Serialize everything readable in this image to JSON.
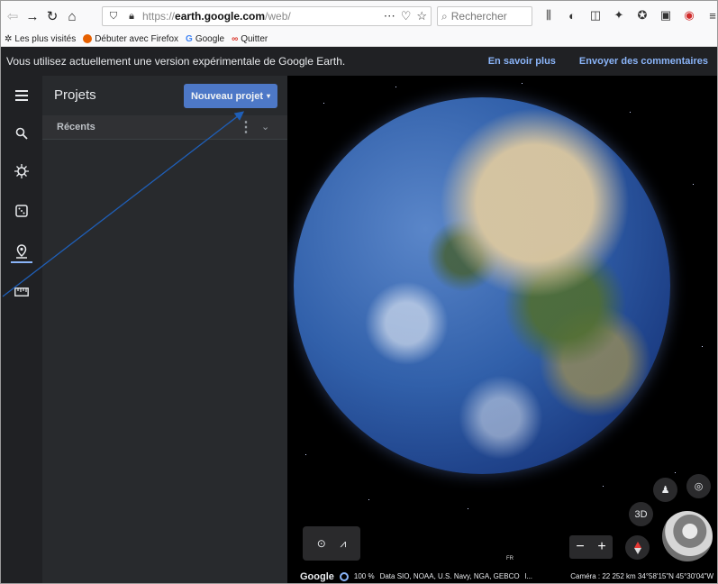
{
  "browser": {
    "url": {
      "prefix": "https://",
      "host": "earth.google.com",
      "path": "/web/"
    },
    "search_placeholder": "Rechercher",
    "bookmarks": [
      "Les plus visités",
      "Débuter avec Firefox",
      "Google",
      "Quitter"
    ]
  },
  "banner": {
    "message": "Vous utilisez actuellement une version expérimentale de Google Earth.",
    "learn_more": "En savoir plus",
    "feedback": "Envoyer des commentaires"
  },
  "panel": {
    "title": "Projets",
    "new_project": "Nouveau projet",
    "recent": "Récents"
  },
  "map": {
    "mode_3d": "3D",
    "zoom_out": "−",
    "zoom_in": "+",
    "country_label": "FR",
    "footer": {
      "brand": "Google",
      "percent": "100 %",
      "data": "Data SIO, NOAA, U.S. Navy, NGA, GEBCO",
      "ellipsis": "l...",
      "camera": "Caméra : 22 252 km  34°58'15\"N 45°30'04\"W"
    }
  },
  "colors": {
    "accent": "#4d78c7",
    "link": "#8ab4f8",
    "dark_bg": "#202124",
    "panel_bg": "#282a2d"
  }
}
